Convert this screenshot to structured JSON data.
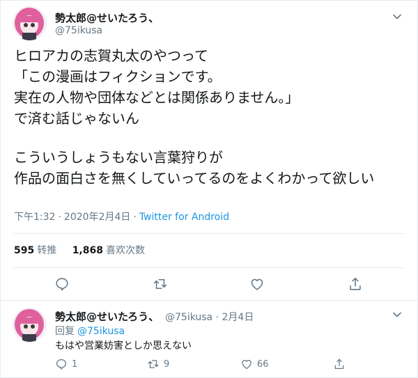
{
  "colors": {
    "link": "#1b95e0",
    "secondary": "#657786",
    "text": "#14171a",
    "border": "#e6ecf0"
  },
  "tweet": {
    "author": {
      "display_name": "勢太郎@せいたろう、",
      "handle": "@75ikusa",
      "avatar": "avatar-icon"
    },
    "text_lines": [
      "ヒロアカの志賀丸太のやつって",
      "「この漫画はフィクションです。",
      "実在の人物や団体などとは関係ありません。」",
      "で済む話じゃないん",
      "",
      "こういうしょうもない言葉狩りが",
      "作品の面白さを無くしていってるのをよくわかって欲しい"
    ],
    "time": "下午1:32",
    "date": "2020年2月4日",
    "separator": "·",
    "source": "Twitter for Android",
    "stats": {
      "retweets_count": "595",
      "retweets_label": "转推",
      "likes_count": "1,868",
      "likes_label": "喜欢次数"
    },
    "actions": [
      "reply-icon",
      "retweet-icon",
      "like-icon",
      "share-icon"
    ]
  },
  "reply": {
    "author": {
      "display_name": "勢太郎@せいたろう、",
      "handle": "@75ikusa",
      "date": "2月4日",
      "separator": "·",
      "avatar": "avatar-icon"
    },
    "replying_label": "回复",
    "replying_to": "@75ikusa",
    "text": "もはや営業妨害としか思えない",
    "counts": {
      "reply": "1",
      "retweet": "9",
      "like": "66"
    }
  }
}
